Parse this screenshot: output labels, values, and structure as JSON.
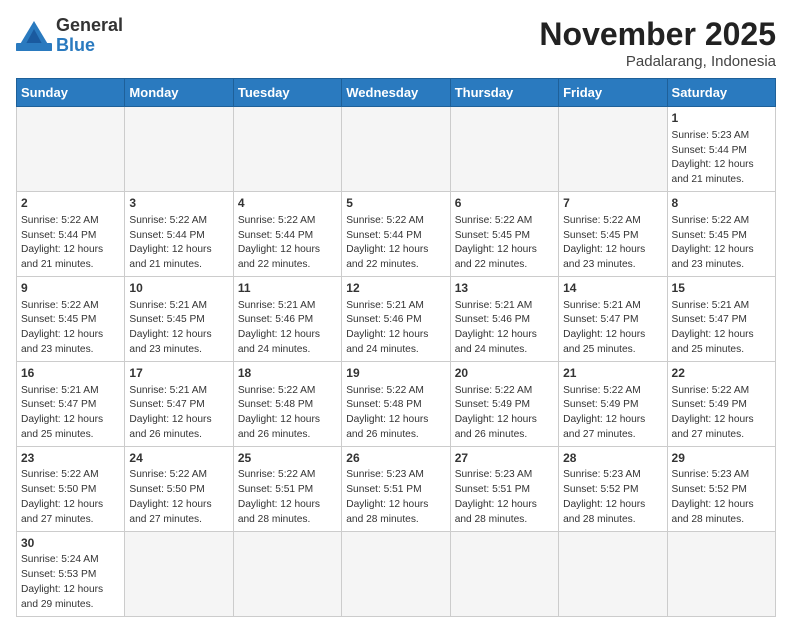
{
  "header": {
    "title": "November 2025",
    "location": "Padalarang, Indonesia",
    "logo_general": "General",
    "logo_blue": "Blue"
  },
  "weekdays": [
    "Sunday",
    "Monday",
    "Tuesday",
    "Wednesday",
    "Thursday",
    "Friday",
    "Saturday"
  ],
  "weeks": [
    [
      {
        "day": "",
        "info": ""
      },
      {
        "day": "",
        "info": ""
      },
      {
        "day": "",
        "info": ""
      },
      {
        "day": "",
        "info": ""
      },
      {
        "day": "",
        "info": ""
      },
      {
        "day": "",
        "info": ""
      },
      {
        "day": "1",
        "info": "Sunrise: 5:23 AM\nSunset: 5:44 PM\nDaylight: 12 hours\nand 21 minutes."
      }
    ],
    [
      {
        "day": "2",
        "info": "Sunrise: 5:22 AM\nSunset: 5:44 PM\nDaylight: 12 hours\nand 21 minutes."
      },
      {
        "day": "3",
        "info": "Sunrise: 5:22 AM\nSunset: 5:44 PM\nDaylight: 12 hours\nand 21 minutes."
      },
      {
        "day": "4",
        "info": "Sunrise: 5:22 AM\nSunset: 5:44 PM\nDaylight: 12 hours\nand 22 minutes."
      },
      {
        "day": "5",
        "info": "Sunrise: 5:22 AM\nSunset: 5:44 PM\nDaylight: 12 hours\nand 22 minutes."
      },
      {
        "day": "6",
        "info": "Sunrise: 5:22 AM\nSunset: 5:45 PM\nDaylight: 12 hours\nand 22 minutes."
      },
      {
        "day": "7",
        "info": "Sunrise: 5:22 AM\nSunset: 5:45 PM\nDaylight: 12 hours\nand 23 minutes."
      },
      {
        "day": "8",
        "info": "Sunrise: 5:22 AM\nSunset: 5:45 PM\nDaylight: 12 hours\nand 23 minutes."
      }
    ],
    [
      {
        "day": "9",
        "info": "Sunrise: 5:22 AM\nSunset: 5:45 PM\nDaylight: 12 hours\nand 23 minutes."
      },
      {
        "day": "10",
        "info": "Sunrise: 5:21 AM\nSunset: 5:45 PM\nDaylight: 12 hours\nand 23 minutes."
      },
      {
        "day": "11",
        "info": "Sunrise: 5:21 AM\nSunset: 5:46 PM\nDaylight: 12 hours\nand 24 minutes."
      },
      {
        "day": "12",
        "info": "Sunrise: 5:21 AM\nSunset: 5:46 PM\nDaylight: 12 hours\nand 24 minutes."
      },
      {
        "day": "13",
        "info": "Sunrise: 5:21 AM\nSunset: 5:46 PM\nDaylight: 12 hours\nand 24 minutes."
      },
      {
        "day": "14",
        "info": "Sunrise: 5:21 AM\nSunset: 5:47 PM\nDaylight: 12 hours\nand 25 minutes."
      },
      {
        "day": "15",
        "info": "Sunrise: 5:21 AM\nSunset: 5:47 PM\nDaylight: 12 hours\nand 25 minutes."
      }
    ],
    [
      {
        "day": "16",
        "info": "Sunrise: 5:21 AM\nSunset: 5:47 PM\nDaylight: 12 hours\nand 25 minutes."
      },
      {
        "day": "17",
        "info": "Sunrise: 5:21 AM\nSunset: 5:47 PM\nDaylight: 12 hours\nand 26 minutes."
      },
      {
        "day": "18",
        "info": "Sunrise: 5:22 AM\nSunset: 5:48 PM\nDaylight: 12 hours\nand 26 minutes."
      },
      {
        "day": "19",
        "info": "Sunrise: 5:22 AM\nSunset: 5:48 PM\nDaylight: 12 hours\nand 26 minutes."
      },
      {
        "day": "20",
        "info": "Sunrise: 5:22 AM\nSunset: 5:49 PM\nDaylight: 12 hours\nand 26 minutes."
      },
      {
        "day": "21",
        "info": "Sunrise: 5:22 AM\nSunset: 5:49 PM\nDaylight: 12 hours\nand 27 minutes."
      },
      {
        "day": "22",
        "info": "Sunrise: 5:22 AM\nSunset: 5:49 PM\nDaylight: 12 hours\nand 27 minutes."
      }
    ],
    [
      {
        "day": "23",
        "info": "Sunrise: 5:22 AM\nSunset: 5:50 PM\nDaylight: 12 hours\nand 27 minutes."
      },
      {
        "day": "24",
        "info": "Sunrise: 5:22 AM\nSunset: 5:50 PM\nDaylight: 12 hours\nand 27 minutes."
      },
      {
        "day": "25",
        "info": "Sunrise: 5:22 AM\nSunset: 5:51 PM\nDaylight: 12 hours\nand 28 minutes."
      },
      {
        "day": "26",
        "info": "Sunrise: 5:23 AM\nSunset: 5:51 PM\nDaylight: 12 hours\nand 28 minutes."
      },
      {
        "day": "27",
        "info": "Sunrise: 5:23 AM\nSunset: 5:51 PM\nDaylight: 12 hours\nand 28 minutes."
      },
      {
        "day": "28",
        "info": "Sunrise: 5:23 AM\nSunset: 5:52 PM\nDaylight: 12 hours\nand 28 minutes."
      },
      {
        "day": "29",
        "info": "Sunrise: 5:23 AM\nSunset: 5:52 PM\nDaylight: 12 hours\nand 28 minutes."
      }
    ],
    [
      {
        "day": "30",
        "info": "Sunrise: 5:24 AM\nSunset: 5:53 PM\nDaylight: 12 hours\nand 29 minutes."
      },
      {
        "day": "",
        "info": ""
      },
      {
        "day": "",
        "info": ""
      },
      {
        "day": "",
        "info": ""
      },
      {
        "day": "",
        "info": ""
      },
      {
        "day": "",
        "info": ""
      },
      {
        "day": "",
        "info": ""
      }
    ]
  ]
}
